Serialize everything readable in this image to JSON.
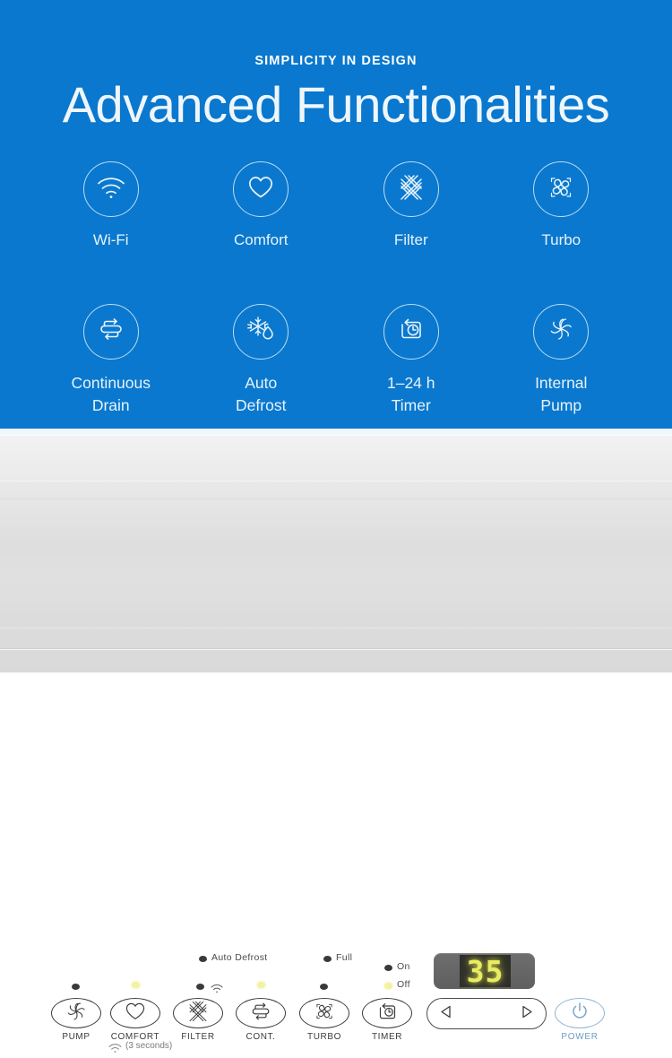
{
  "theme": {
    "brand_blue": "#0a78ce",
    "hero_text": "#eef6fb",
    "panel_gray": "#e0e0e0",
    "led_on": "#f2f2a0",
    "led_off": "#3a3a3a",
    "display_digit_color": "#e9ec62",
    "power_blue": "#6f9cc3"
  },
  "hero": {
    "eyebrow": "SIMPLICITY IN DESIGN",
    "headline": "Advanced Functionalities",
    "features": [
      {
        "label": "Wi-Fi",
        "icon": "wifi-icon"
      },
      {
        "label": "Comfort",
        "icon": "heart-icon"
      },
      {
        "label": "Filter",
        "icon": "filter-mesh-icon"
      },
      {
        "label": "Turbo",
        "icon": "fan-turbo-icon"
      },
      {
        "label": "Continuous\nDrain",
        "icon": "continuous-drain-icon"
      },
      {
        "label": "Auto\nDefrost",
        "icon": "snowflake-droplet-icon"
      },
      {
        "label": "1–24 h\nTimer",
        "icon": "timer-clock-icon"
      },
      {
        "label": "Internal\nPump",
        "icon": "pump-impeller-icon"
      }
    ]
  },
  "control_panel": {
    "status_indicators": [
      {
        "label": "Auto Defrost",
        "state": "off"
      },
      {
        "label": "Full",
        "state": "off"
      },
      {
        "label": "On",
        "state": "off"
      },
      {
        "label": "Off",
        "state": "on"
      }
    ],
    "display": {
      "value": "35"
    },
    "buttons": [
      {
        "label": "PUMP",
        "icon": "pump-impeller-icon",
        "led": "off"
      },
      {
        "label": "COMFORT",
        "icon": "heart-icon",
        "led": "on"
      },
      {
        "label": "FILTER",
        "icon": "filter-mesh-icon",
        "led": "off"
      },
      {
        "label": "CONT.",
        "icon": "continuous-drain-icon",
        "led": "on"
      },
      {
        "label": "TURBO",
        "icon": "fan-turbo-icon",
        "led": "off"
      },
      {
        "label": "TIMER",
        "icon": "timer-clock-icon",
        "led": "none"
      }
    ],
    "wifi_hint": "(3 seconds)",
    "rocker": {
      "left": "decrease-arrow",
      "right": "increase-arrow"
    },
    "power": {
      "label": "POWER",
      "icon": "power-icon"
    }
  }
}
